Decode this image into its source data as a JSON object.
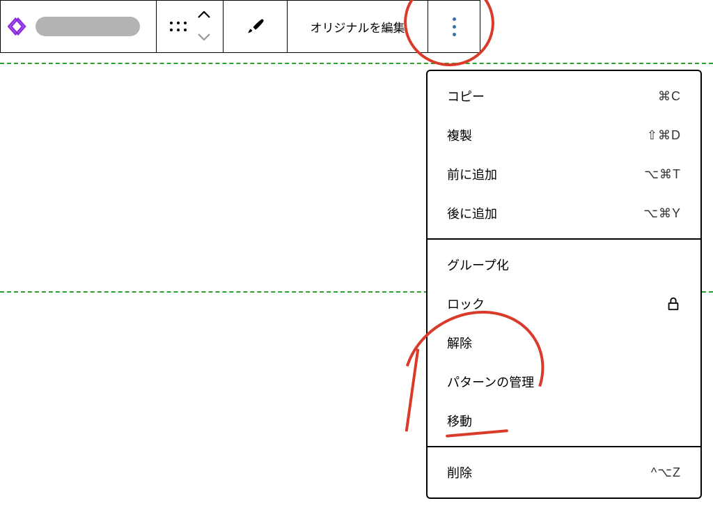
{
  "toolbar": {
    "edit_original_label": "オリジナルを編集"
  },
  "menu": {
    "group1": [
      {
        "label": "コピー",
        "shortcut": "⌘C"
      },
      {
        "label": "複製",
        "shortcut": "⇧⌘D"
      },
      {
        "label": "前に追加",
        "shortcut": "⌥⌘T"
      },
      {
        "label": "後に追加",
        "shortcut": "⌥⌘Y"
      }
    ],
    "group2": [
      {
        "label": "グループ化",
        "shortcut": ""
      },
      {
        "label": "ロック",
        "shortcut": "",
        "icon": "lock"
      },
      {
        "label": "解除",
        "shortcut": ""
      },
      {
        "label": "パターンの管理",
        "shortcut": ""
      },
      {
        "label": "移動",
        "shortcut": ""
      }
    ],
    "group3": [
      {
        "label": "削除",
        "shortcut": "^⌥Z"
      }
    ]
  },
  "colors": {
    "annotation": "#d93a2a",
    "dashed": "#2ca02c",
    "accent": "#8a2be2",
    "more_dots": "#3a6ea5"
  }
}
